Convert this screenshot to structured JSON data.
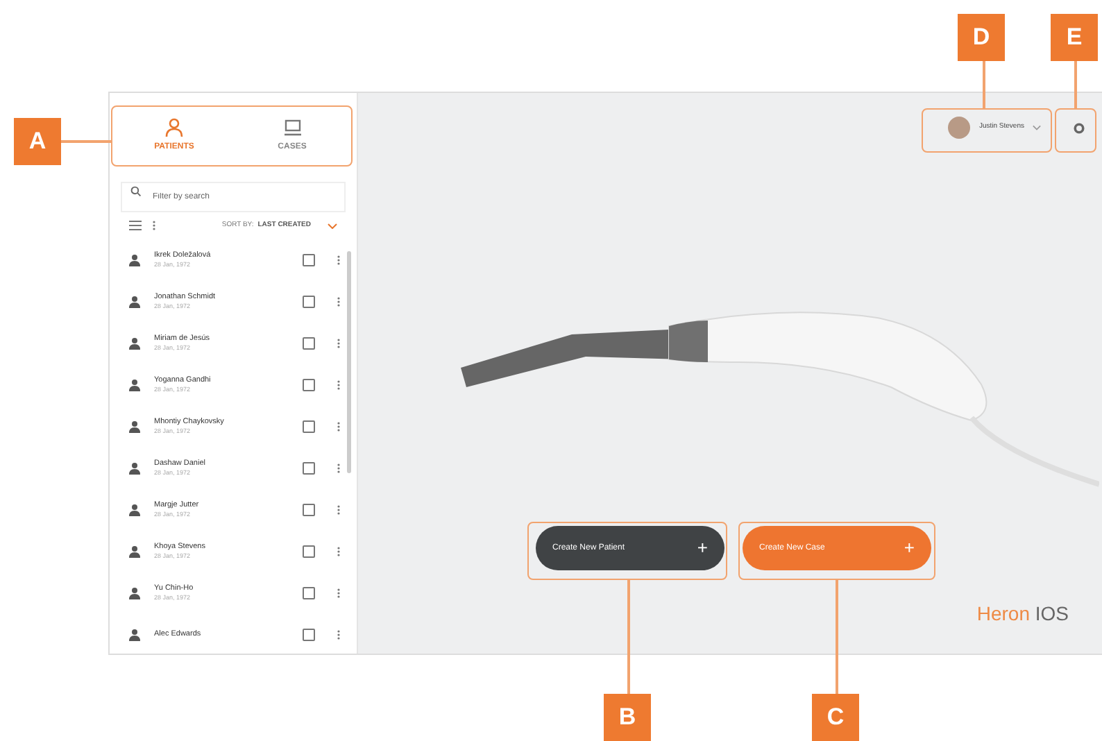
{
  "sidebar": {
    "tabs": [
      {
        "label": "PATIENTS",
        "selected": true
      },
      {
        "label": "CASES",
        "selected": false
      }
    ],
    "search": {
      "placeholder": "Filter by search"
    },
    "sort": {
      "label": "SORT BY:",
      "value": "LAST CREATED"
    },
    "patients": [
      {
        "name": "Ikrek Doležalová",
        "date": "28 Jan, 1972",
        "checked": false
      },
      {
        "name": "Jonathan Schmidt",
        "date": "28 Jan, 1972",
        "checked": false
      },
      {
        "name": "Miriam de Jesús",
        "date": "28 Jan, 1972",
        "checked": false
      },
      {
        "name": "Yoganna Gandhi",
        "date": "28 Jan, 1972",
        "checked": false
      },
      {
        "name": "Mhontiy Chaykovsky",
        "date": "28 Jan, 1972",
        "checked": false
      },
      {
        "name": "Dashaw Daniel",
        "date": "28 Jan, 1972",
        "checked": false
      },
      {
        "name": "Margje Jutter",
        "date": "28 Jan, 1972",
        "checked": false
      },
      {
        "name": "Khoya Stevens",
        "date": "28 Jan, 1972",
        "checked": false
      },
      {
        "name": "Yu Chin-Ho",
        "date": "28 Jan, 1972",
        "checked": false
      },
      {
        "name": "Alec Edwards",
        "checked": false
      }
    ]
  },
  "user": {
    "name": "Justin Stevens"
  },
  "buttons": [
    {
      "label": "Create New Patient",
      "kind": "dark",
      "icon": "+"
    },
    {
      "label": "Create New Case",
      "kind": "primary",
      "icon": "+"
    }
  ],
  "brand": {
    "part_1": "Heron",
    "part_2": "IOS"
  },
  "callouts": [
    {
      "label": "A"
    },
    {
      "label": "B"
    },
    {
      "label": "C"
    },
    {
      "label": "D"
    },
    {
      "label": "E"
    }
  ]
}
